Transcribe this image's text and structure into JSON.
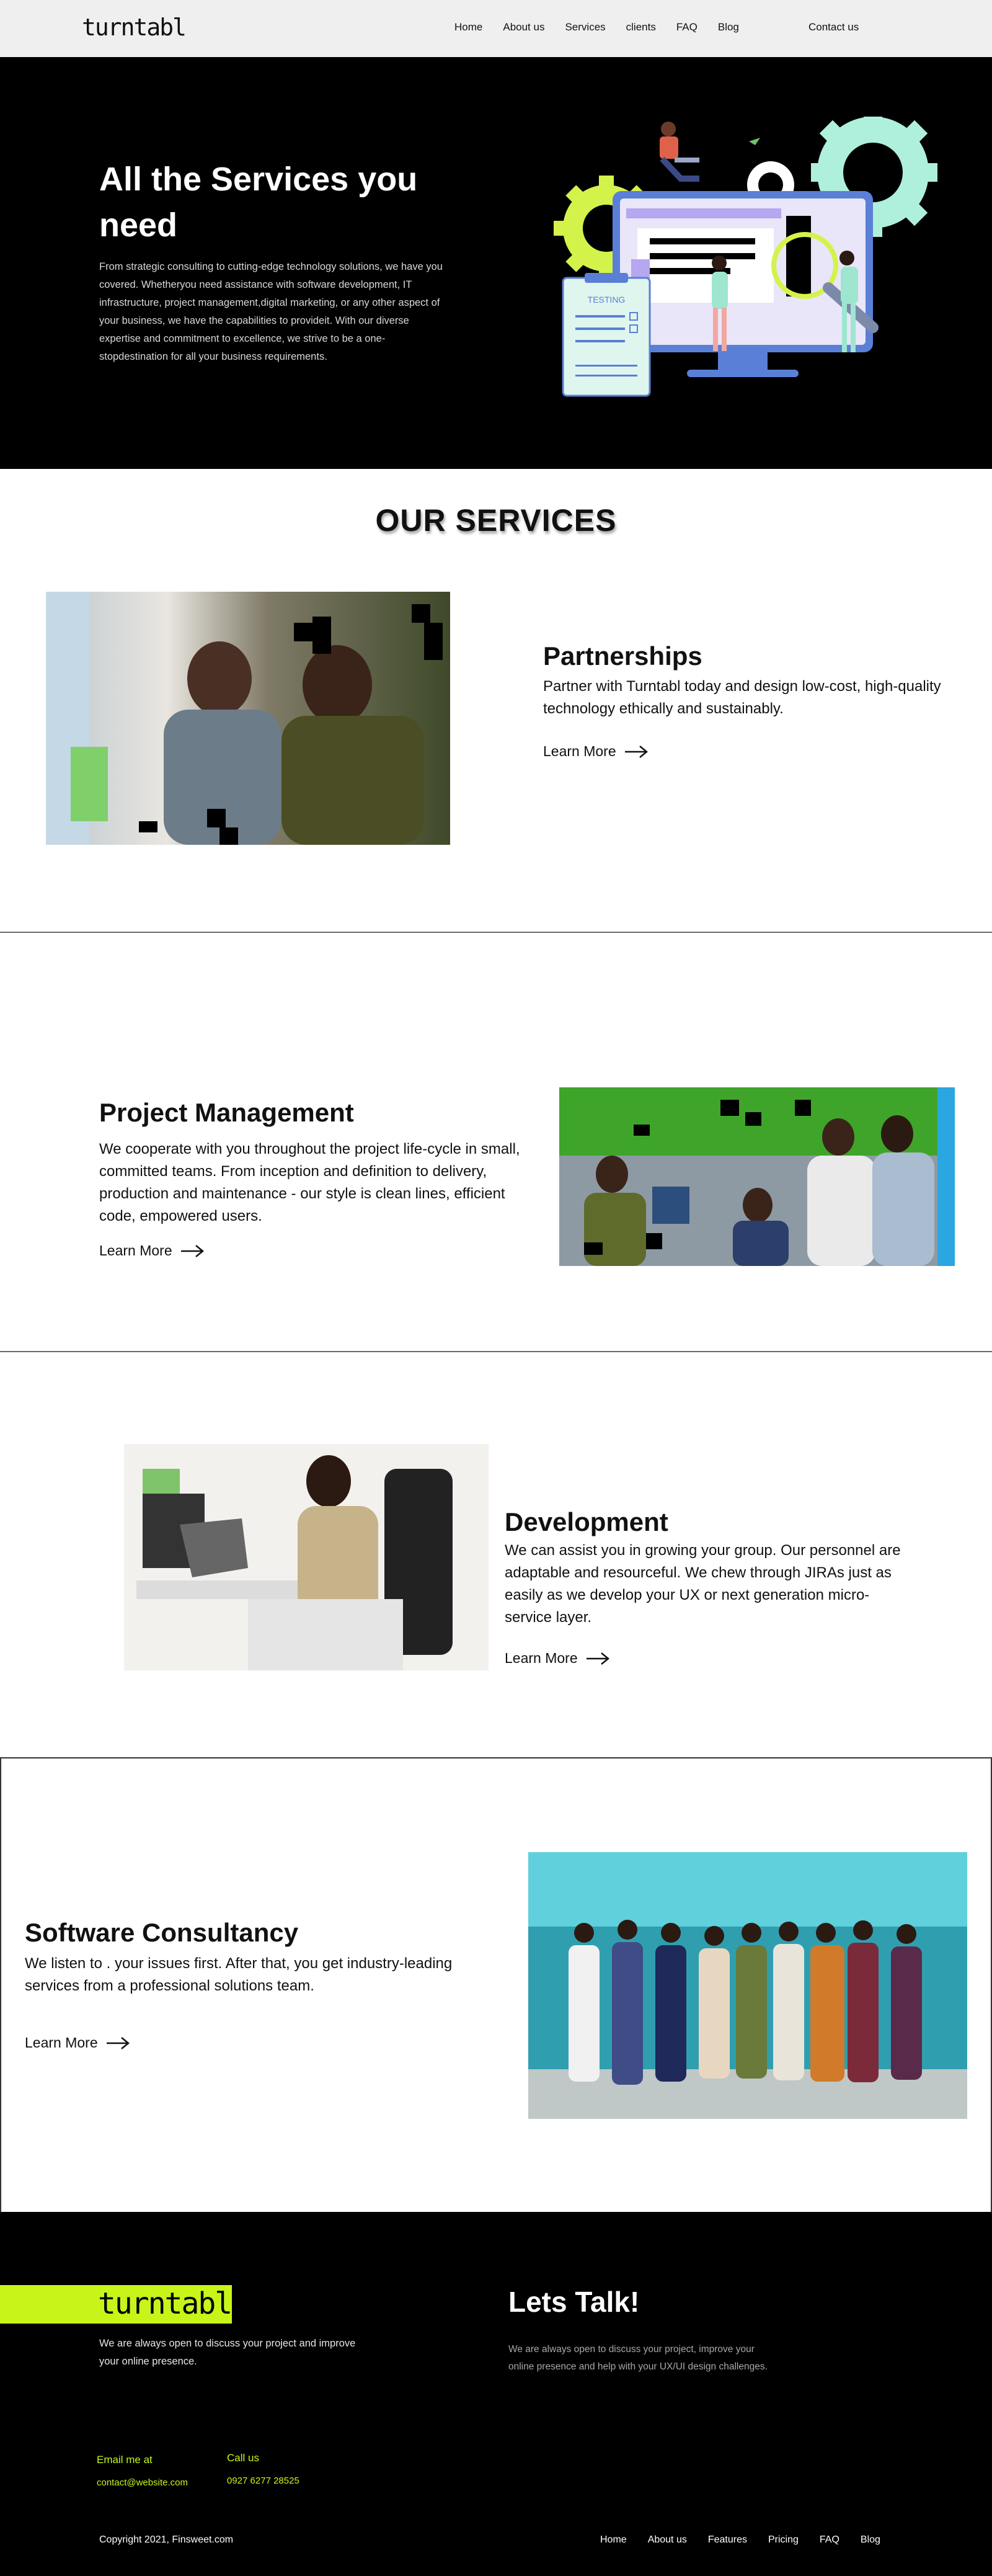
{
  "nav": {
    "logo": "turntabl",
    "links": [
      "Home",
      "About us",
      "Services",
      "clients",
      "FAQ",
      "Blog"
    ],
    "contact": "Contact us"
  },
  "hero": {
    "title": "All the Services you need",
    "description": "From strategic consulting to cutting-edge technology solutions, we have you covered. Whetheryou need assistance with software development, IT infrastructure, project management,digital marketing, or any other aspect of your business, we have the capabilities to provideit. With our diverse expertise and commitment to excellence, we strive to be a one-stopdestination for all your business requirements.",
    "illustration_label": "TESTING"
  },
  "services_title": "OUR SERVICES",
  "services": [
    {
      "title": "Partnerships",
      "description": "Partner with Turntabl today and design low-cost, high-quality technology ethically and sustainably.",
      "link": "Learn More"
    },
    {
      "title": "Project Management",
      "description": "We cooperate with you throughout the project life-cycle in small, committed teams. From inception and definition to delivery, production and maintenance - our style is clean lines, efficient code, empowered users.",
      "link": "Learn More"
    },
    {
      "title": "Development",
      "description": "We can assist you in growing your group. Our personnel are adaptable and resourceful. We chew through JIRAs just as easily as we develop your UX or next generation micro-service layer.",
      "link": "Learn More"
    },
    {
      "title": "Software Consultancy",
      "description": "We listen to . your issues first. After that, you get industry-leading services from a professional solutions team.",
      "link": "Learn More"
    }
  ],
  "footer": {
    "logo": "turntabl",
    "open_text": "We are always open to discuss your project and improve your online presence.",
    "talk_title": "Lets Talk!",
    "talk_text": "We are always open to discuss your project, improve your online presence and help with your UX/UI design challenges.",
    "email_label": "Email me at",
    "email": "contact@website.com",
    "call_label": "Call us",
    "phone": "0927 6277 28525",
    "copyright": "Copyright 2021, Finsweet.com",
    "links": [
      "Home",
      "About us",
      "Features",
      "Pricing",
      "FAQ",
      "Blog"
    ]
  },
  "colors": {
    "accent": "#c7f51a",
    "hero_bg": "#000000",
    "nav_bg": "#efefef"
  }
}
